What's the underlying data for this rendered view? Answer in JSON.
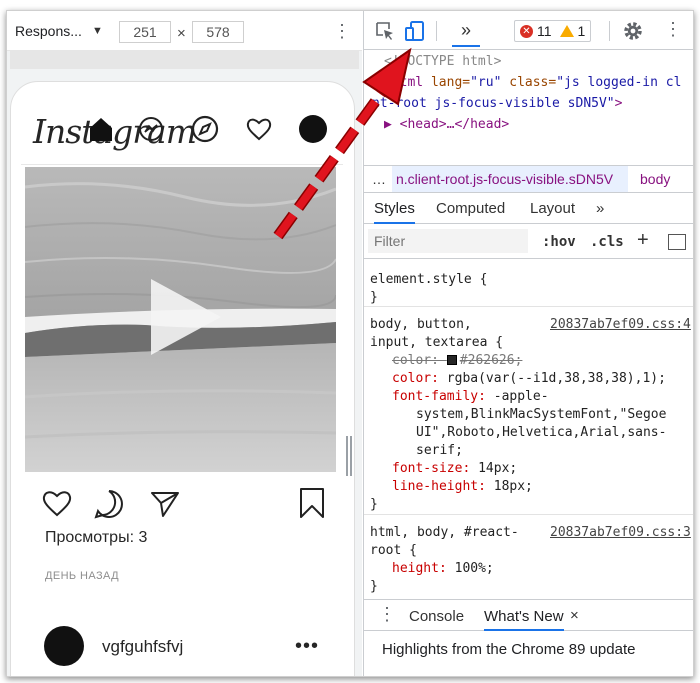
{
  "device_toolbar": {
    "device_label": "Respons...",
    "caret": "▼",
    "width": "251",
    "times": "×",
    "height": "578",
    "more": "⋮"
  },
  "instagram": {
    "logo": "Instagram",
    "views": "Просмотры: 3",
    "time": "ДЕНЬ НАЗАД",
    "next_user": "vgfguhfsfvj",
    "more": "•••"
  },
  "devtools": {
    "more_tabs": "»",
    "errors": "11",
    "warnings": "1",
    "menu": "⋮",
    "dom": {
      "line1": "<!DOCTYPE html>",
      "line2_tag": "<html",
      "line2_attr1": "lang=",
      "line2_val1": "\"ru\"",
      "line2_attr2": "class=",
      "line2_val2": "\"js logged-in cl",
      "line3_val": "nt-root js-focus-visible sDN5V\"",
      "line3_end": ">",
      "line4": "▶ <head>…</head>"
    },
    "breadcrumbs": {
      "ellipsis": "…",
      "selected": "n.client-root.js-focus-visible.sDN5V",
      "body": "body"
    },
    "tabs": {
      "styles": "Styles",
      "computed": "Computed",
      "layout": "Layout",
      "more": "»"
    },
    "filter": {
      "placeholder": "Filter",
      "hov": ":hov",
      "cls": ".cls",
      "plus": "+"
    },
    "styles": {
      "element_style": "element.style {",
      "close": "}",
      "rule1_sel1": "body, button,",
      "rule1_src": "20837ab7ef09.css:4",
      "rule1_sel2": "input, textarea {",
      "color_old_prop": "color:",
      "color_old_val": "#262626;",
      "color_prop": "color:",
      "color_val": "rgba(var(--i1d,38,38,38),1);",
      "ff_prop": "font-family:",
      "ff_val1": "-apple-",
      "ff_val2": "system,BlinkMacSystemFont,\"Segoe",
      "ff_val3": "UI\",Roboto,Helvetica,Arial,sans-",
      "ff_val4": "serif;",
      "fs_prop": "font-size:",
      "fs_val": "14px;",
      "lh_prop": "line-height:",
      "lh_val": "18px;",
      "rule2_sel1": "html, body, #react-",
      "rule2_src": "20837ab7ef09.css:3",
      "rule2_sel2": "root {",
      "h_prop": "height:",
      "h_val": "100%;"
    },
    "drawer": {
      "dots": "⋮",
      "console": "Console",
      "whats_new": "What's New",
      "close": "×",
      "highlight": "Highlights from the Chrome 89 update"
    }
  },
  "colors": {
    "accent": "#1a73e8",
    "arrow": "#e0141e",
    "error": "#d93025",
    "warning": "#f9ab00"
  }
}
